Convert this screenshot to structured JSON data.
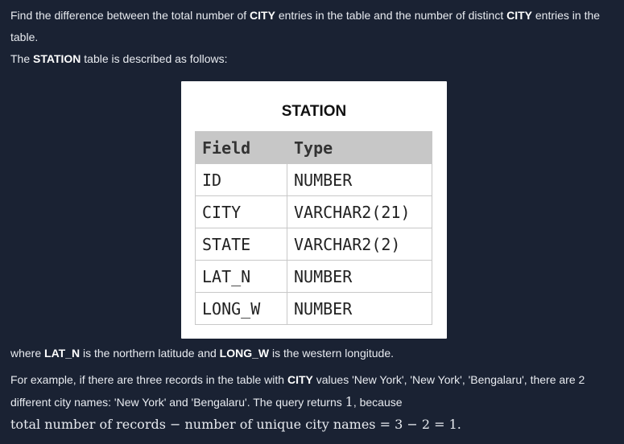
{
  "intro": {
    "line1_a": "Find the difference between the total number of ",
    "line1_b": "CITY",
    "line1_c": " entries in the table and the number of distinct ",
    "line1_d": "CITY",
    "line1_e": " entries in the table.",
    "line2_a": "The ",
    "line2_b": "STATION",
    "line2_c": " table is described as follows:"
  },
  "station_table": {
    "title": "STATION",
    "headers": [
      "Field",
      "Type"
    ],
    "rows": [
      [
        "ID",
        "NUMBER"
      ],
      [
        "CITY",
        "VARCHAR2(21)"
      ],
      [
        "STATE",
        "VARCHAR2(2)"
      ],
      [
        "LAT_N",
        "NUMBER"
      ],
      [
        "LONG_W",
        "NUMBER"
      ]
    ]
  },
  "notes": {
    "where_a": "where ",
    "where_b": "LAT_N",
    "where_c": " is the northern latitude and ",
    "where_d": "LONG_W",
    "where_e": " is the western longitude.",
    "example_a": "For example, if there are three records in the table with ",
    "example_b": "CITY",
    "example_c": " values 'New York', 'New York', 'Bengalaru', there are 2 different city names: 'New York' and 'Bengalaru'. The query returns ",
    "example_d": "1",
    "example_e": ", because",
    "formula": "total number of records − number of unique city names = 3 − 2 = 1."
  }
}
